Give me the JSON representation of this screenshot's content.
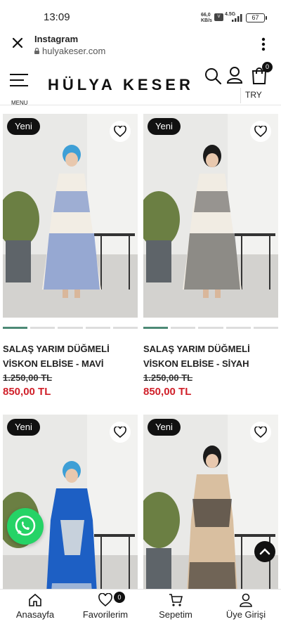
{
  "status": {
    "time": "13:09",
    "speed": "66,0",
    "speed_unit": "KB/s",
    "network": "4.5G",
    "battery": "67"
  },
  "browser": {
    "title": "Instagram",
    "url": "hulyakeser.com"
  },
  "header": {
    "menu_label": "MENU",
    "logo": "HÜLYA KESER",
    "cart_count": "0",
    "currency": "TRY"
  },
  "products": [
    {
      "badge": "Yeni",
      "name": "SALAŞ YARIM DÜĞMELİ VİSKON ELBİSE - MAVİ",
      "old_price": "1.250,00 TL",
      "price": "850,00 TL"
    },
    {
      "badge": "Yeni",
      "name": "SALAŞ YARIM DÜĞMELİ VİSKON ELBİSE - SİYAH",
      "old_price": "1.250,00 TL",
      "price": "850,00 TL"
    },
    {
      "badge": "Yeni"
    },
    {
      "badge": "Yeni"
    }
  ],
  "bottom_nav": {
    "home": "Anasayfa",
    "favorites": "Favorilerim",
    "favorites_count": "0",
    "cart": "Sepetim",
    "account": "Üye Girişi"
  },
  "colors": {
    "price_red": "#d0202a",
    "badge_black": "#111111",
    "slider_active": "#4d8a76",
    "whatsapp": "#25d366"
  }
}
